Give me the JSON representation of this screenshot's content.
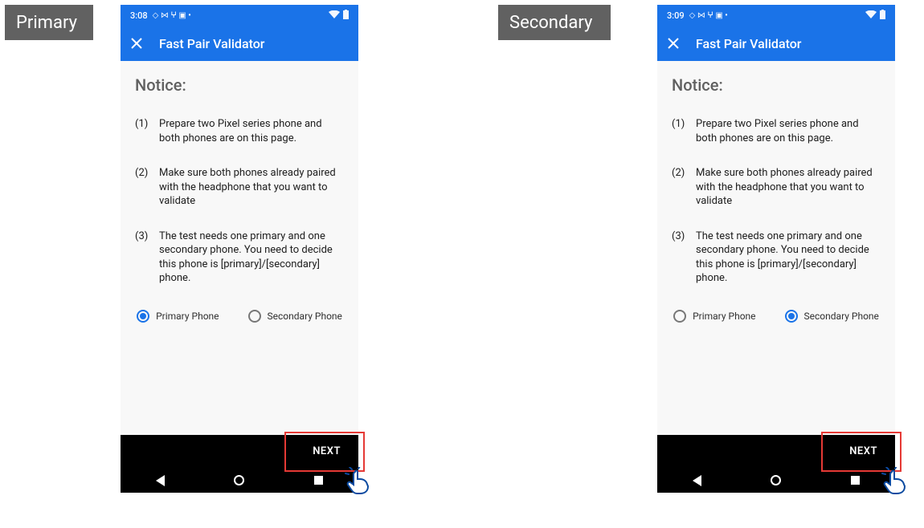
{
  "tags": {
    "left": "Primary",
    "right": "Secondary"
  },
  "phones": {
    "left": {
      "status_time": "3:08",
      "app_title": "Fast Pair Validator",
      "notice_heading": "Notice:",
      "steps": [
        "Prepare two Pixel series phone and both phones are on this page.",
        "Make sure both phones already paired with the headphone that you want to validate",
        "The test needs one primary and one secondary phone. You need to decide this phone is [primary]/[secondary] phone."
      ],
      "radio": {
        "primary_label": "Primary Phone",
        "secondary_label": "Secondary Phone",
        "selected": "primary"
      },
      "next_label": "NEXT"
    },
    "right": {
      "status_time": "3:09",
      "app_title": "Fast Pair Validator",
      "notice_heading": "Notice:",
      "steps": [
        "Prepare two Pixel series phone and both phones are on this page.",
        "Make sure both phones already paired with the headphone that you want to validate",
        "The test needs one primary and one secondary phone. You need to decide this phone is [primary]/[secondary] phone."
      ],
      "radio": {
        "primary_label": "Primary Phone",
        "secondary_label": "Secondary Phone",
        "selected": "secondary"
      },
      "next_label": "NEXT"
    }
  },
  "icons": {
    "status_cluster": "◇ ⋈ ⵖ ▣ •",
    "wifi": "▾",
    "battery": "▮"
  }
}
